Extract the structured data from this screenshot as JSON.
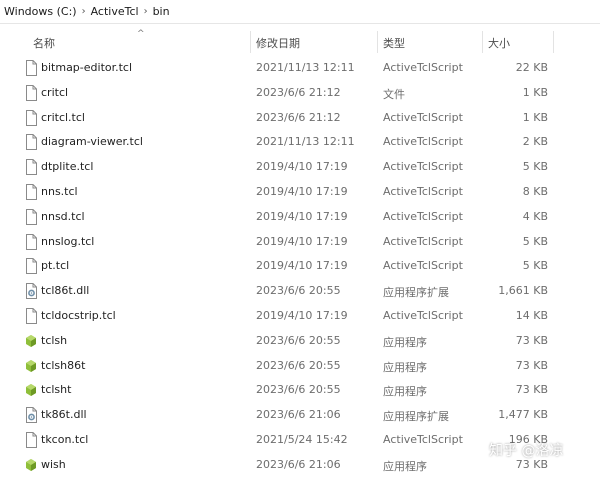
{
  "breadcrumb": [
    "Windows (C:)",
    "ActiveTcl",
    "bin"
  ],
  "columns": {
    "name": "名称",
    "date": "修改日期",
    "type": "类型",
    "size": "大小"
  },
  "files": [
    {
      "name": "bitmap-editor.tcl",
      "date": "2021/11/13 12:11",
      "type": "ActiveTclScript",
      "size": "22 KB",
      "icon": "file-icon"
    },
    {
      "name": "critcl",
      "date": "2023/6/6 21:12",
      "type": "文件",
      "size": "1 KB",
      "icon": "file-icon"
    },
    {
      "name": "critcl.tcl",
      "date": "2023/6/6 21:12",
      "type": "ActiveTclScript",
      "size": "1 KB",
      "icon": "file-icon"
    },
    {
      "name": "diagram-viewer.tcl",
      "date": "2021/11/13 12:11",
      "type": "ActiveTclScript",
      "size": "2 KB",
      "icon": "file-icon"
    },
    {
      "name": "dtplite.tcl",
      "date": "2019/4/10 17:19",
      "type": "ActiveTclScript",
      "size": "5 KB",
      "icon": "file-icon"
    },
    {
      "name": "nns.tcl",
      "date": "2019/4/10 17:19",
      "type": "ActiveTclScript",
      "size": "8 KB",
      "icon": "file-icon"
    },
    {
      "name": "nnsd.tcl",
      "date": "2019/4/10 17:19",
      "type": "ActiveTclScript",
      "size": "4 KB",
      "icon": "file-icon"
    },
    {
      "name": "nnslog.tcl",
      "date": "2019/4/10 17:19",
      "type": "ActiveTclScript",
      "size": "5 KB",
      "icon": "file-icon"
    },
    {
      "name": "pt.tcl",
      "date": "2019/4/10 17:19",
      "type": "ActiveTclScript",
      "size": "5 KB",
      "icon": "file-icon"
    },
    {
      "name": "tcl86t.dll",
      "date": "2023/6/6 20:55",
      "type": "应用程序扩展",
      "size": "1,661 KB",
      "icon": "dll-icon"
    },
    {
      "name": "tcldocstrip.tcl",
      "date": "2019/4/10 17:19",
      "type": "ActiveTclScript",
      "size": "14 KB",
      "icon": "file-icon"
    },
    {
      "name": "tclsh",
      "date": "2023/6/6 20:55",
      "type": "应用程序",
      "size": "73 KB",
      "icon": "exe-icon"
    },
    {
      "name": "tclsh86t",
      "date": "2023/6/6 20:55",
      "type": "应用程序",
      "size": "73 KB",
      "icon": "exe-icon"
    },
    {
      "name": "tclsht",
      "date": "2023/6/6 20:55",
      "type": "应用程序",
      "size": "73 KB",
      "icon": "exe-icon"
    },
    {
      "name": "tk86t.dll",
      "date": "2023/6/6 21:06",
      "type": "应用程序扩展",
      "size": "1,477 KB",
      "icon": "dll-icon"
    },
    {
      "name": "tkcon.tcl",
      "date": "2021/5/24 15:42",
      "type": "ActiveTclScript",
      "size": "196 KB",
      "icon": "file-icon"
    },
    {
      "name": "wish",
      "date": "2023/6/6 21:06",
      "type": "应用程序",
      "size": "73 KB",
      "icon": "exe-icon"
    }
  ],
  "watermark": "知乎 @洛凉",
  "colors": {
    "exe_icon": "#8fbf3a",
    "dll_gear": "#6f8fa8"
  }
}
